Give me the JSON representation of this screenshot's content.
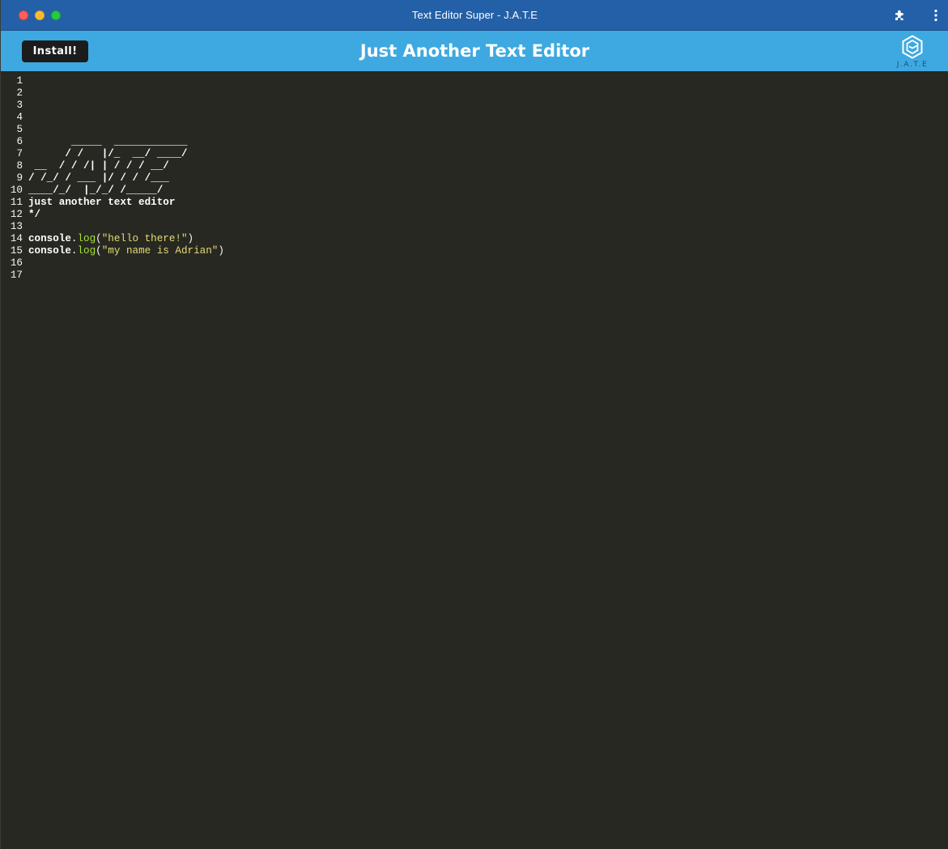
{
  "window": {
    "title": "Text Editor Super - J.A.T.E"
  },
  "header": {
    "install_label": "Install!",
    "title": "Just Another Text Editor",
    "logo_text": "J.A.T.E"
  },
  "icons": {
    "extensions": "puzzle-icon",
    "menu": "kebab-menu-icon",
    "logo": "hexagon-logo-icon"
  },
  "colors": {
    "titlebar": "#2460a7",
    "header": "#3ea9e0",
    "editor_bg": "#272822",
    "string": "#e6db74",
    "property": "#a6e22e"
  },
  "editor": {
    "lines": [
      {
        "num": "1",
        "text": ""
      },
      {
        "num": "2",
        "text": ""
      },
      {
        "num": "3",
        "text": ""
      },
      {
        "num": "4",
        "text": ""
      },
      {
        "num": "5",
        "text": ""
      },
      {
        "num": "6",
        "text": "       _____  ____________"
      },
      {
        "num": "7",
        "text": "      / /   |/_  __/ ____/"
      },
      {
        "num": "8",
        "text": " __  / / /| | / / / __/"
      },
      {
        "num": "9",
        "text": "/ /_/ / ___ |/ / / /___"
      },
      {
        "num": "10",
        "text": "____/_/  |_/_/ /_____/"
      },
      {
        "num": "11",
        "text": "just another text editor"
      },
      {
        "num": "12",
        "text": "*/"
      },
      {
        "num": "13",
        "text": ""
      },
      {
        "num": "14",
        "code": {
          "obj": "console",
          "dot": ".",
          "method": "log",
          "open": "(",
          "str": "\"hello there!\"",
          "close": ")"
        }
      },
      {
        "num": "15",
        "code": {
          "obj": "console",
          "dot": ".",
          "method": "log",
          "open": "(",
          "str": "\"my name is Adrian\"",
          "close": ")"
        }
      },
      {
        "num": "16",
        "text": ""
      },
      {
        "num": "17",
        "text": ""
      }
    ]
  }
}
